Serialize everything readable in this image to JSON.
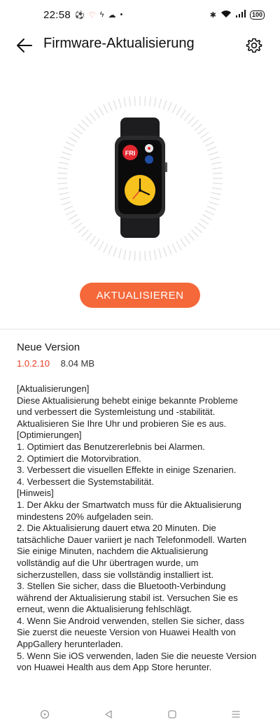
{
  "status_bar": {
    "time": "22:58",
    "battery": "100"
  },
  "app_bar": {
    "title": "Firmware-Aktualisierung"
  },
  "device": {
    "day_label": "FRI",
    "accent_color": "#f4683a"
  },
  "update_button": {
    "label": "AKTUALISIEREN"
  },
  "version": {
    "heading": "Neue Version",
    "number": "1.0.2.10",
    "size": "8.04 MB"
  },
  "release_notes": [
    "[Aktualisierungen]",
    "Diese Aktualisierung behebt einige bekannte Probleme",
    "und verbessert die Systemleistung und -stabilität.",
    "Aktualisieren Sie Ihre Uhr und probieren Sie es aus.",
    "[Optimierungen]",
    "1. Optimiert das Benutzererlebnis bei Alarmen.",
    "2. Optimiert die Motorvibration.",
    "3. Verbessert die visuellen Effekte in einige Szenarien.",
    "4. Verbessert die Systemstabilität.",
    "[Hinweis]",
    "1. Der Akku der Smartwatch muss für die Aktualisierung",
    "mindestens 20% aufgeladen sein.",
    "2. Die Aktualisierung dauert etwa 20 Minuten. Die",
    "tatsächliche Dauer variiert je nach Telefonmodell. Warten",
    "Sie einige Minuten, nachdem die Aktualisierung",
    "vollständig auf die Uhr übertragen wurde, um",
    "sicherzustellen, dass sie vollständig installiert ist.",
    "3. Stellen Sie sicher, dass die Bluetooth-Verbindung",
    "während der Aktualisierung stabil ist. Versuchen Sie es",
    "erneut, wenn die Aktualisierung fehlschlägt.",
    "4. Wenn Sie Android verwenden, stellen Sie sicher, dass",
    "Sie zuerst die neueste Version von Huawei Health von",
    "AppGallery herunterladen.",
    "5. Wenn Sie iOS verwenden, laden Sie die neueste Version",
    "von Huawei Health aus dem App Store herunter."
  ]
}
